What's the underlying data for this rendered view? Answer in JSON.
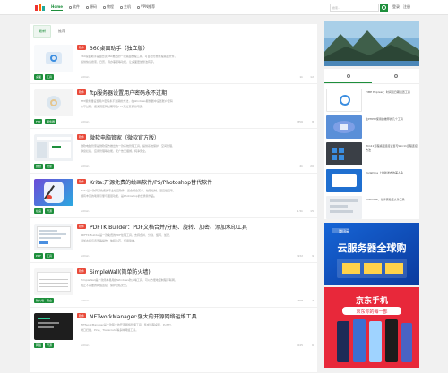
{
  "header": {
    "nav": [
      "Home",
      "软件",
      "源码",
      "教程",
      "主机",
      "VPN推荐"
    ],
    "search_placeholder": "搜索...",
    "login": "登录",
    "register": "注册"
  },
  "tabs": [
    "最新",
    "推荐"
  ],
  "posts": [
    {
      "cat": "软件",
      "title": "360桌面助手（独立版）",
      "excerpt1": "360桌面助手是由奇虎360推出的一款桌面整理工具，可自动分类整理桌面文件，",
      "excerpt2": "提供快速搜索、日历、待办事项等功能，让桌面更加整洁有序。",
      "tag1": "桌面",
      "tag2": "工具",
      "author": "admin",
      "views": "1k",
      "likes": "12"
    },
    {
      "cat": "软件",
      "title": "ftp服务器设置用户密码永不过期",
      "excerpt1": "FTP服务器设置用户密码永不过期的方法，在Windows服务器中设置账户密码",
      "excerpt2": "永不过期，避免因密码过期导致FTP无法登录的问题。",
      "tag1": "FTP",
      "tag2": "服务器",
      "author": "admin",
      "views": "856",
      "likes": "8"
    },
    {
      "cat": "软件",
      "title": "微软电脑管家（微软官方版）",
      "excerpt1": "微软电脑管家是微软官方推出的一款系统管理工具，提供系统保护、空间管理、",
      "excerpt2": "弹窗拦截、应用管理等功能，无广告无捆绑，纯净安全。",
      "tag1": "微软",
      "tag2": "管家",
      "author": "admin",
      "views": "2k",
      "likes": "20"
    },
    {
      "cat": "软件",
      "title": "Krita:开源免费的绘画软件/PS/Photoshop替代软件",
      "excerpt1": "Krita是一款开源免费的专业绘画软件，适合概念美术、纹理绘制、漫画插画等，",
      "excerpt2": "拥有丰富的笔刷引擎与图层功能，是Photoshop的优秀替代品。",
      "tag1": "绘画",
      "tag2": "开源",
      "author": "admin",
      "views": "1.5k",
      "likes": "15"
    },
    {
      "cat": "软件",
      "title": "PDFTK Builder：PDF文档合并/分割、旋转、加密、添加水印工具",
      "excerpt1": "PDFTK Builder是一款免费的PDF处理工具，支持合并、分割、旋转、加密、",
      "excerpt2": "添加水印与背景等操作，体积小巧，使用简单。",
      "tag1": "PDF",
      "tag2": "工具",
      "author": "admin",
      "views": "932",
      "likes": "9"
    },
    {
      "cat": "软件",
      "title": "SimpleWall(简单防火墙)",
      "excerpt1": "SimpleWall是一款简单易用的Windows防火墙工具，可以方便地控制程序联网，",
      "excerpt2": "阻止不需要的网络连接，保护隐私安全。",
      "tag1": "防火墙",
      "tag2": "安全",
      "author": "admin",
      "views": "768",
      "likes": "7"
    },
    {
      "cat": "软件",
      "title": "NETworkManager:强大的开源网络运维工具",
      "excerpt1": "NETworkManager是一款强大的开源网络管理工具，集成远程桌面、PuTTY、",
      "excerpt2": "端口扫描、Ping、Traceroute等多种网络工具。",
      "tag1": "网络",
      "tag2": "开源",
      "author": "admin",
      "views": "645",
      "likes": "6"
    }
  ],
  "sidebar": {
    "items": [
      "TIME Express：时间和日期设置工具",
      "在PHP中使用的推荐的几个工具",
      "Win11远程桌面连接设置与Win11远程连接方法",
      "Vodafone 上线新发布的美人鱼",
      "Chemtab：化学实验室文件工具"
    ]
  },
  "ads": {
    "ad1_text": "云服务器全球购",
    "ad1_sub": "腾讯云",
    "ad2_text": "京东手机",
    "ad2_sub": "京东你的每一部"
  }
}
